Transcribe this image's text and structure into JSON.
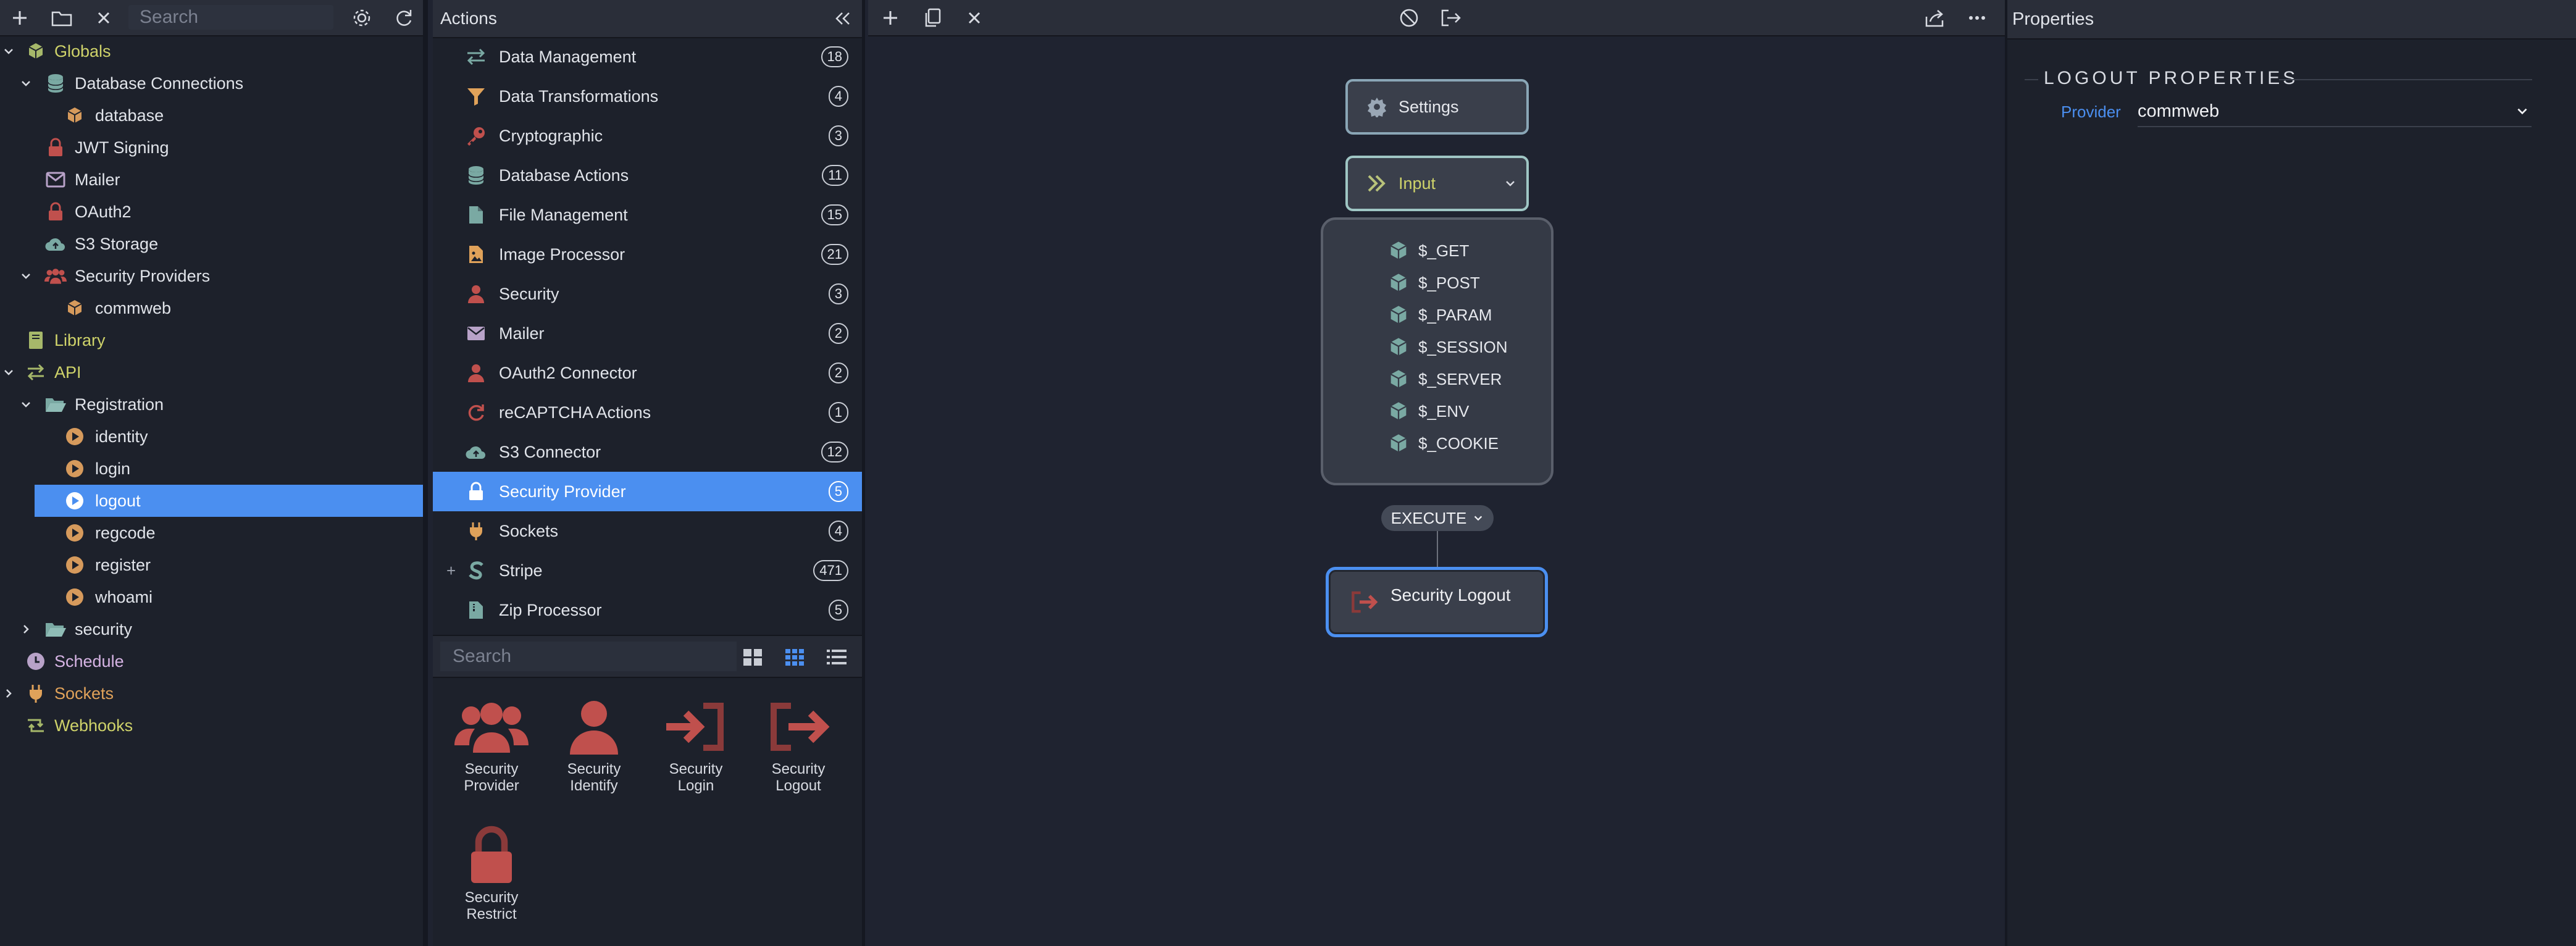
{
  "left_panel": {
    "search_placeholder": "Search",
    "tree": [
      {
        "label": "Globals"
      },
      {
        "label": "Database Connections"
      },
      {
        "label": "database"
      },
      {
        "label": "JWT Signing"
      },
      {
        "label": "Mailer"
      },
      {
        "label": "OAuth2"
      },
      {
        "label": "S3 Storage"
      },
      {
        "label": "Security Providers"
      },
      {
        "label": "commweb"
      },
      {
        "label": "Library"
      },
      {
        "label": "API"
      },
      {
        "label": "Registration"
      },
      {
        "label": "identity"
      },
      {
        "label": "login"
      },
      {
        "label": "logout"
      },
      {
        "label": "regcode"
      },
      {
        "label": "register"
      },
      {
        "label": "whoami"
      },
      {
        "label": "security"
      },
      {
        "label": "Schedule"
      },
      {
        "label": "Sockets"
      },
      {
        "label": "Webhooks"
      }
    ]
  },
  "actions_panel": {
    "title": "Actions",
    "items": [
      {
        "label": "Data Management",
        "count": "18"
      },
      {
        "label": "Data Transformations",
        "count": "4"
      },
      {
        "label": "Cryptographic",
        "count": "3"
      },
      {
        "label": "Database Actions",
        "count": "11"
      },
      {
        "label": "File Management",
        "count": "15"
      },
      {
        "label": "Image Processor",
        "count": "21"
      },
      {
        "label": "Security",
        "count": "3"
      },
      {
        "label": "Mailer",
        "count": "2"
      },
      {
        "label": "OAuth2 Connector",
        "count": "2"
      },
      {
        "label": "reCAPTCHA Actions",
        "count": "1"
      },
      {
        "label": "S3 Connector",
        "count": "12"
      },
      {
        "label": "Security Provider",
        "count": "5"
      },
      {
        "label": "Sockets",
        "count": "4"
      },
      {
        "label": "Stripe",
        "count": "471"
      },
      {
        "label": "Zip Processor",
        "count": "5"
      }
    ],
    "search_placeholder": "Search",
    "tiles": [
      {
        "label1": "Security",
        "label2": "Provider"
      },
      {
        "label1": "Security",
        "label2": "Identify"
      },
      {
        "label1": "Security",
        "label2": "Login"
      },
      {
        "label1": "Security",
        "label2": "Logout"
      },
      {
        "label1": "Security",
        "label2": "Restrict"
      }
    ]
  },
  "canvas": {
    "settings_label": "Settings",
    "input_label": "Input",
    "variables": [
      "$_GET",
      "$_POST",
      "$_PARAM",
      "$_SESSION",
      "$_SERVER",
      "$_ENV",
      "$_COOKIE"
    ],
    "execute_label": "EXECUTE",
    "step_label": "Security Logout"
  },
  "properties": {
    "title": "Properties",
    "section": "LOGOUT PROPERTIES",
    "provider_label": "Provider",
    "provider_value": "commweb"
  },
  "colors": {
    "accent": "#4b8ff0",
    "security_red": "#c0504d",
    "globals_yellow": "#cfd36a",
    "orange": "#e0a25a"
  }
}
